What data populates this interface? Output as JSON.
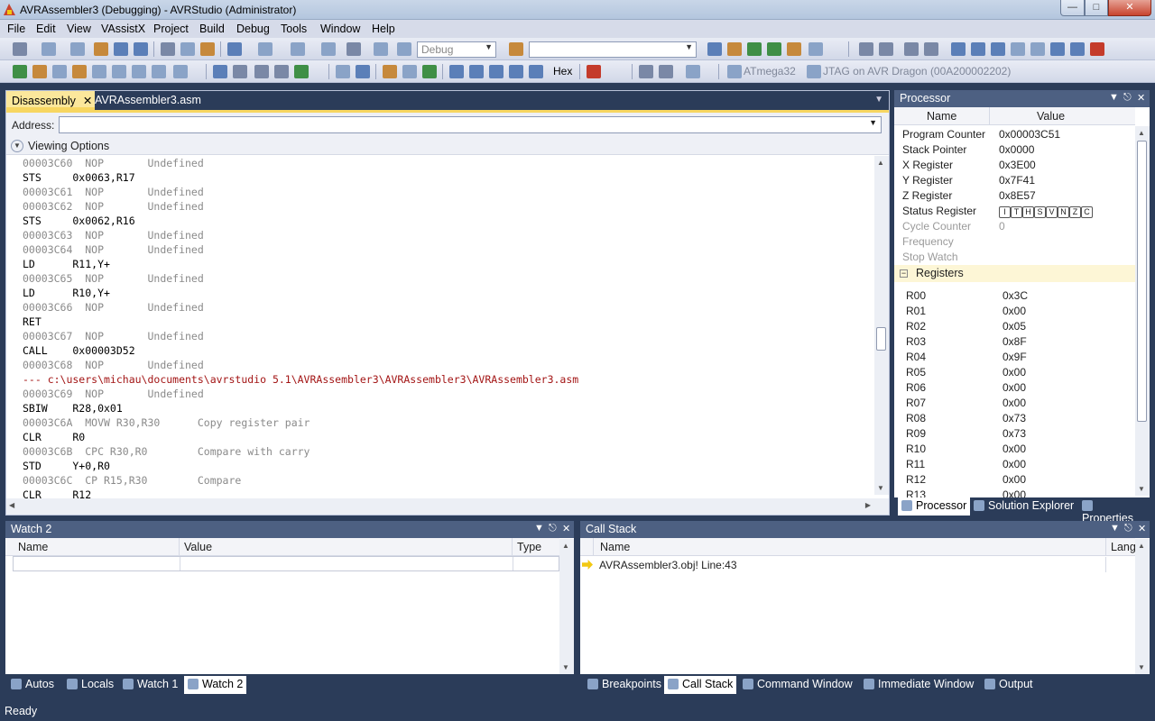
{
  "window": {
    "title": "AVRAssembler3 (Debugging) - AVRStudio (Administrator)"
  },
  "menu": [
    "File",
    "Edit",
    "View",
    "VAssistX",
    "Project",
    "Build",
    "Debug",
    "Tools",
    "Window",
    "Help"
  ],
  "toolbar": {
    "config_combo": "Debug",
    "hex_label": "Hex",
    "device": "ATmega32",
    "tool": "JTAG on AVR Dragon (00A200002202)"
  },
  "editor": {
    "tabs": [
      {
        "label": "Disassembly",
        "active": true,
        "close": "✕"
      },
      {
        "label": "AVRAssembler3.asm",
        "active": false
      }
    ],
    "address_label": "Address:",
    "address_value": "",
    "viewing_options": "Viewing Options",
    "lines": [
      {
        "kind": "addr",
        "text": "00003C60  NOP       Undefined"
      },
      {
        "kind": "instr",
        "text": "STS     0x0063,R17"
      },
      {
        "kind": "addr",
        "text": "00003C61  NOP       Undefined"
      },
      {
        "kind": "addr",
        "text": "00003C62  NOP       Undefined"
      },
      {
        "kind": "instr",
        "text": "STS     0x0062,R16"
      },
      {
        "kind": "addr",
        "text": "00003C63  NOP       Undefined"
      },
      {
        "kind": "addr",
        "text": "00003C64  NOP       Undefined"
      },
      {
        "kind": "instr",
        "text": "LD      R11,Y+"
      },
      {
        "kind": "addr",
        "text": "00003C65  NOP       Undefined"
      },
      {
        "kind": "instr",
        "text": "LD      R10,Y+"
      },
      {
        "kind": "addr",
        "text": "00003C66  NOP       Undefined"
      },
      {
        "kind": "instr",
        "text": "RET"
      },
      {
        "kind": "addr",
        "text": "00003C67  NOP       Undefined"
      },
      {
        "kind": "instr",
        "text": "CALL    0x00003D52"
      },
      {
        "kind": "addr",
        "text": "00003C68  NOP       Undefined"
      },
      {
        "kind": "src",
        "text": "--- c:\\users\\michau\\documents\\avrstudio 5.1\\AVRAssembler3\\AVRAssembler3\\AVRAssembler3.asm"
      },
      {
        "kind": "addr",
        "text": "00003C69  NOP       Undefined"
      },
      {
        "kind": "instr",
        "text": "SBIW    R28,0x01"
      },
      {
        "kind": "addr",
        "text": "00003C6A  MOVW R30,R30      Copy register pair"
      },
      {
        "kind": "instr",
        "text": "CLR     R0"
      },
      {
        "kind": "addr",
        "text": "00003C6B  CPC R30,R0        Compare with carry"
      },
      {
        "kind": "instr",
        "text": "STD     Y+0,R0"
      },
      {
        "kind": "addr",
        "text": "00003C6C  CP R15,R30        Compare"
      },
      {
        "kind": "instr",
        "text": "CLR     R12"
      }
    ]
  },
  "processor": {
    "title": "Processor",
    "col_name": "Name",
    "col_value": "Value",
    "rows": [
      {
        "name": "Program Counter",
        "value": "0x00003C51",
        "dim": false
      },
      {
        "name": "Stack Pointer",
        "value": "0x0000",
        "dim": false
      },
      {
        "name": "X Register",
        "value": "0x3E00",
        "dim": false
      },
      {
        "name": "Y Register",
        "value": "0x7F41",
        "dim": false
      },
      {
        "name": "Z Register",
        "value": "0x8E57",
        "dim": false
      },
      {
        "name": "Status Register",
        "value": "",
        "dim": false
      },
      {
        "name": "Cycle Counter",
        "value": "0",
        "dim": true
      },
      {
        "name": "Frequency",
        "value": "",
        "dim": true
      },
      {
        "name": "Stop Watch",
        "value": "",
        "dim": true
      }
    ],
    "flags": [
      "I",
      "T",
      "H",
      "S",
      "V",
      "N",
      "Z",
      "C"
    ],
    "registers_label": "Registers",
    "registers": [
      {
        "name": "R00",
        "value": "0x3C"
      },
      {
        "name": "R01",
        "value": "0x00"
      },
      {
        "name": "R02",
        "value": "0x05"
      },
      {
        "name": "R03",
        "value": "0x8F"
      },
      {
        "name": "R04",
        "value": "0x9F"
      },
      {
        "name": "R05",
        "value": "0x00"
      },
      {
        "name": "R06",
        "value": "0x00"
      },
      {
        "name": "R07",
        "value": "0x00"
      },
      {
        "name": "R08",
        "value": "0x73"
      },
      {
        "name": "R09",
        "value": "0x73"
      },
      {
        "name": "R10",
        "value": "0x00"
      },
      {
        "name": "R11",
        "value": "0x00"
      },
      {
        "name": "R12",
        "value": "0x00"
      },
      {
        "name": "R13",
        "value": "0x00"
      }
    ],
    "tabs": [
      "Processor",
      "Solution Explorer",
      "Properties"
    ]
  },
  "watch": {
    "title": "Watch 2",
    "col_name": "Name",
    "col_value": "Value",
    "col_type": "Type",
    "tabs": [
      "Autos",
      "Locals",
      "Watch 1",
      "Watch 2"
    ]
  },
  "callstack": {
    "title": "Call Stack",
    "col_name": "Name",
    "col_lang": "Lang",
    "row": "AVRAssembler3.obj!  Line:43",
    "tabs": [
      "Breakpoints",
      "Call Stack",
      "Command Window",
      "Immediate Window",
      "Output"
    ]
  },
  "status": {
    "text": "Ready"
  }
}
